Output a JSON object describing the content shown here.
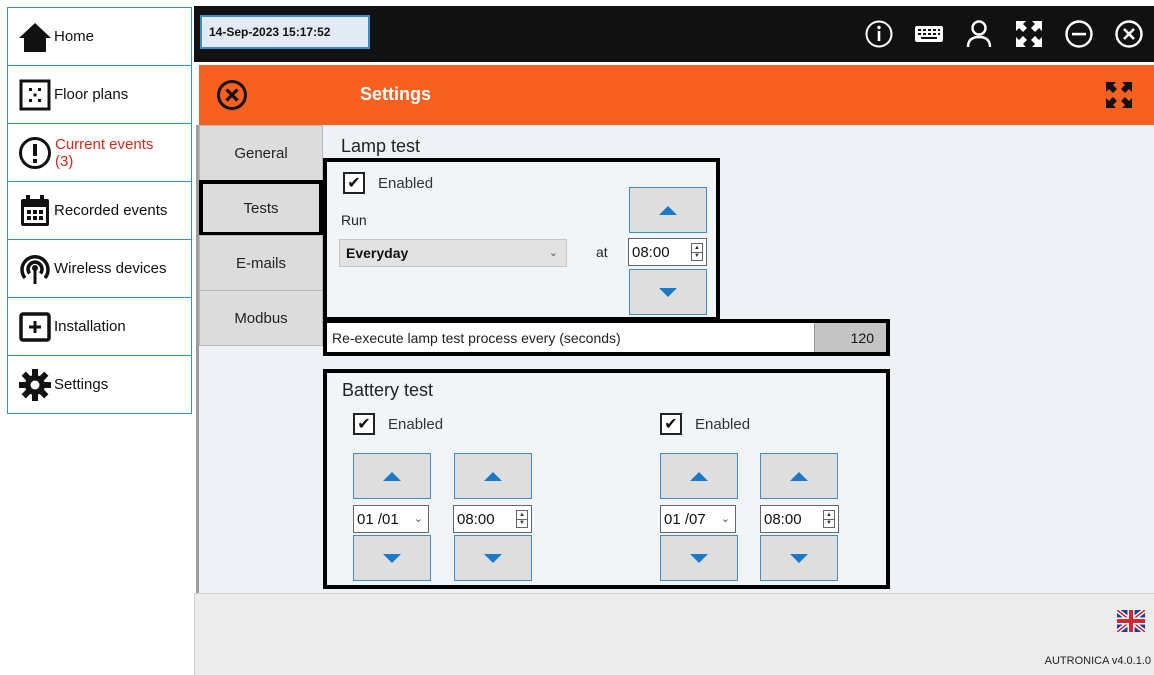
{
  "nav": {
    "items": [
      {
        "label": "Home",
        "icon": "home-icon"
      },
      {
        "label": "Floor plans",
        "icon": "floor-plan-icon"
      },
      {
        "label": "Current events",
        "count": "(3)",
        "icon": "alert-circle-icon"
      },
      {
        "label": "Recorded events",
        "icon": "calendar-icon"
      },
      {
        "label": "Wireless devices",
        "icon": "wireless-icon"
      },
      {
        "label": "Installation",
        "icon": "installation-icon"
      },
      {
        "label": "Settings",
        "icon": "gear-icon"
      }
    ]
  },
  "topbar": {
    "datetime": "14-Sep-2023 15:17:52",
    "icons": [
      "info-icon",
      "keyboard-icon",
      "user-icon",
      "fullscreen-icon",
      "minimize-icon",
      "close-icon"
    ]
  },
  "settings": {
    "title": "Settings",
    "tabs": [
      "General",
      "Tests",
      "E-mails",
      "Modbus"
    ],
    "active_tab": "Tests"
  },
  "lamp_test": {
    "title": "Lamp test",
    "enabled_label": "Enabled",
    "enabled": true,
    "run_label": "Run",
    "run_value": "Everyday",
    "at_label": "at",
    "time": "08:00",
    "reexec_label": "Re-execute lamp test process every (seconds)",
    "reexec_value": "120"
  },
  "battery_test": {
    "title": "Battery test",
    "schedules": [
      {
        "enabled_label": "Enabled",
        "enabled": true,
        "date": "01 /01",
        "time": "08:00"
      },
      {
        "enabled_label": "Enabled",
        "enabled": true,
        "date": "01 /07",
        "time": "08:00"
      }
    ]
  },
  "footer": {
    "version": "AUTRONICA v4.0.1.0",
    "language_icon": "uk-flag-icon"
  },
  "colors": {
    "accent": "#f7601e",
    "topbar": "#111111",
    "nav_border": "#3a8ed0",
    "alert": "#e0241b",
    "arrow": "#1a7ac9"
  }
}
